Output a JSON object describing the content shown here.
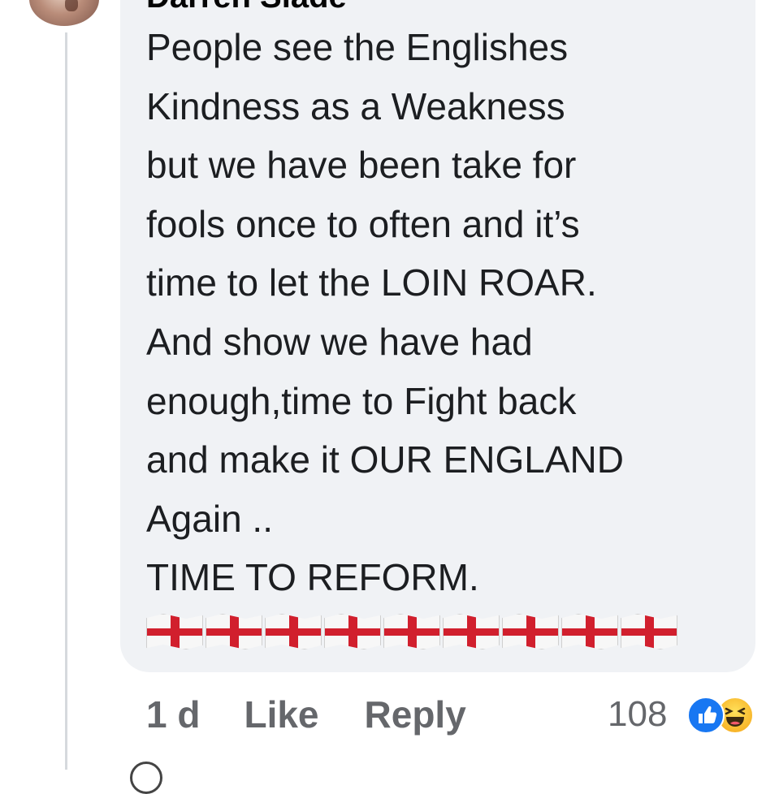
{
  "comment": {
    "author": "Darren Slade",
    "lines": [
      "People see the Englishes",
      "Kindness as a Weakness",
      "but we have been take for",
      "fools once to often and it’s",
      "time to let the LOIN ROAR.",
      "And show we have had",
      "enough,time to Fight back",
      "and make it OUR ENGLAND",
      "Again ..",
      "TIME TO REFORM."
    ],
    "flag_count": 9
  },
  "actions": {
    "timestamp": "1 d",
    "like_label": "Like",
    "reply_label": "Reply"
  },
  "reactions": {
    "count": "108",
    "types": [
      "like-icon",
      "haha-icon"
    ],
    "colors": {
      "like": "#1877f2",
      "haha": "#f7b125"
    }
  },
  "colors": {
    "bubble_background": "#f0f2f5",
    "action_text": "#65676b",
    "flag_cross": "#d11f2d"
  }
}
